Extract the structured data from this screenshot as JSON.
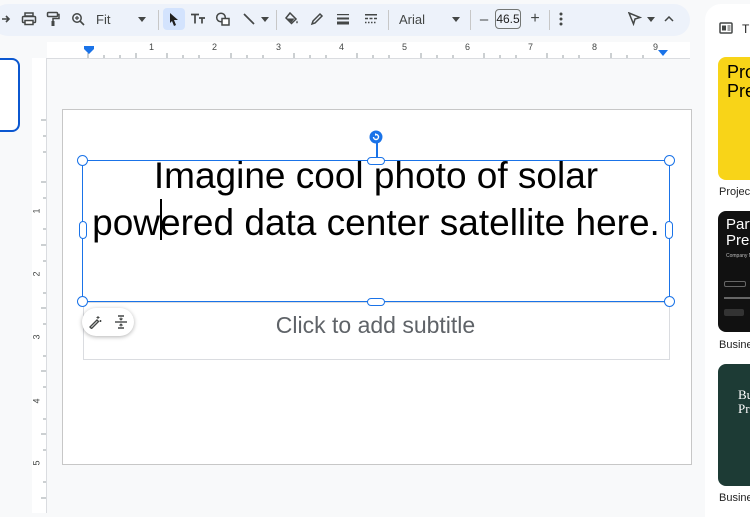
{
  "toolbar": {
    "zoom_label": "Fit",
    "font_name": "Arial",
    "font_size": "46.5",
    "minus_label": "–",
    "plus_label": "+"
  },
  "ruler": {
    "h_numbers": [
      "1",
      "2",
      "3",
      "4",
      "5",
      "6",
      "7",
      "8",
      "9"
    ],
    "v_numbers": [
      "1",
      "2",
      "3",
      "4",
      "5"
    ]
  },
  "slide": {
    "title": "Imagine cool photo of solar powered data center satellite here.",
    "subtitle_placeholder": "Click to add subtitle"
  },
  "right_panel": {
    "header_letter": "T",
    "templates": [
      {
        "preview_line1": "Pro",
        "preview_line2": "Pre",
        "label": "Projec",
        "bg": "#f8d418",
        "fg": "#000000"
      },
      {
        "preview_line1": "Part",
        "preview_line2": "Pres",
        "preview_sub": "Company N",
        "label": "Busine",
        "bg": "#111111",
        "fg": "#ffffff"
      },
      {
        "preview_line1": "Bu",
        "preview_line2": "Pr",
        "label": "Busine",
        "bg": "#1d3b35",
        "fg": "#ffffff"
      }
    ]
  },
  "colors": {
    "accent": "#1a73e8",
    "toolbar_bg": "#edf2fa",
    "selected_tool_bg": "#d3e3fd"
  }
}
